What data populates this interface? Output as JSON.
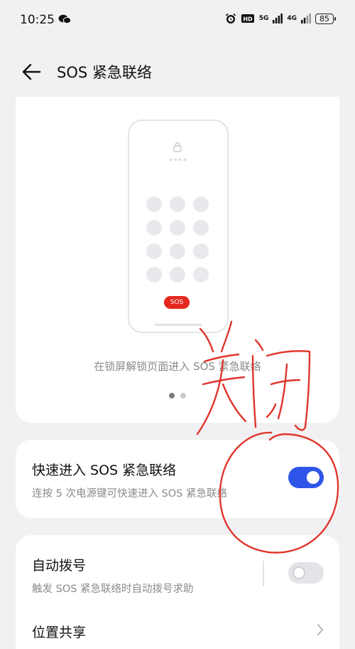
{
  "status_bar": {
    "time": "10:25",
    "network_5g": "5G",
    "network_4g": "4G",
    "battery": "85",
    "icons": [
      "wechat-icon",
      "alarm-icon",
      "hd-icon",
      "signal-icon",
      "battery-icon"
    ]
  },
  "header": {
    "title": "SOS 紧急联络",
    "back_icon": "arrow-left-icon"
  },
  "hero": {
    "pin_mask": "****",
    "sos_label": "SOS",
    "caption": "在锁屏解锁页面进入 SOS 紧急联络",
    "page_count": 2,
    "active_page": 1
  },
  "quick_entry": {
    "title": "快速进入 SOS 紧急联络",
    "subtitle": "连按 5 次电源键可快速进入 SOS 紧急联络",
    "enabled": true
  },
  "auto_dial": {
    "title": "自动拨号",
    "subtitle": "触发 SOS 紧急联络时自动拨号求助",
    "enabled": false
  },
  "location_share": {
    "title": "位置共享"
  },
  "annotation": {
    "handwritten_text": "关闭",
    "color": "#e0352b"
  },
  "colors": {
    "accent": "#2f55e8",
    "sos_red": "#e6271f",
    "background": "#f1f1f3"
  }
}
